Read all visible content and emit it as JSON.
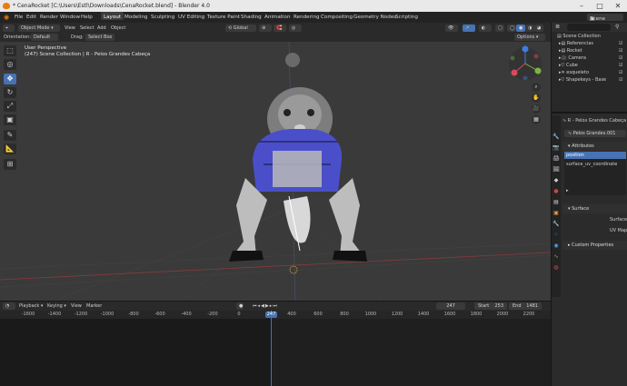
{
  "window": {
    "title": "* CenaRocket [C:\\Users\\Estl\\Downloads\\CenaRocket.blend] - Blender 4.0"
  },
  "menu": {
    "items": [
      "File",
      "Edit",
      "Render",
      "Window",
      "Help"
    ],
    "workspaces": [
      "Layout",
      "Modeling",
      "Sculpting",
      "UV Editing",
      "Texture Paint",
      "Shading",
      "Animation",
      "Rendering",
      "Compositing",
      "Geometry Nodes",
      "Scripting"
    ],
    "active_workspace": "Layout",
    "scene": "Scene"
  },
  "viewport_header": {
    "mode": "Object Mode",
    "menus": [
      "View",
      "Select",
      "Add",
      "Object"
    ],
    "transform_orientation": "Global",
    "orientation_label": "Orientation:",
    "orientation_value": "Default",
    "drag_label": "Drag:",
    "drag_value": "Select Box",
    "options": "Options"
  },
  "viewport": {
    "perspective": "User Perspective",
    "collection": "(247) Scene Collection | R - Pelos Grandes Cabeça"
  },
  "outliner": {
    "root": "Scene Collection",
    "items": [
      {
        "label": "Referencias"
      },
      {
        "label": "Rocket"
      },
      {
        "label": "Camera"
      },
      {
        "label": "Cube"
      },
      {
        "label": "esqueleto"
      },
      {
        "label": "Shapekeys - Base"
      }
    ]
  },
  "properties": {
    "object_name": "R - Pelos Grandes Cabeça",
    "data_name": "Pelos Grandes.001",
    "sections": {
      "attributes": "Attributes",
      "surface": "Surface",
      "custom": "Custom Properties"
    },
    "attributes": [
      "position",
      "surface_uv_coordinate"
    ],
    "surface_fields": [
      "Surface",
      "UV Map"
    ]
  },
  "timeline": {
    "menus": [
      "Playback",
      "Keying",
      "View",
      "Marker"
    ],
    "current_frame": "247",
    "start_label": "Start",
    "start": "253",
    "end_label": "End",
    "end": "1481",
    "ruler": [
      "-1600",
      "-1400",
      "-1200",
      "-1000",
      "-800",
      "-600",
      "-400",
      "-200",
      "0",
      "200",
      "400",
      "600",
      "800",
      "1000",
      "1200",
      "1400",
      "1600",
      "1800",
      "2000",
      "2200"
    ],
    "playhead_label": "247"
  }
}
